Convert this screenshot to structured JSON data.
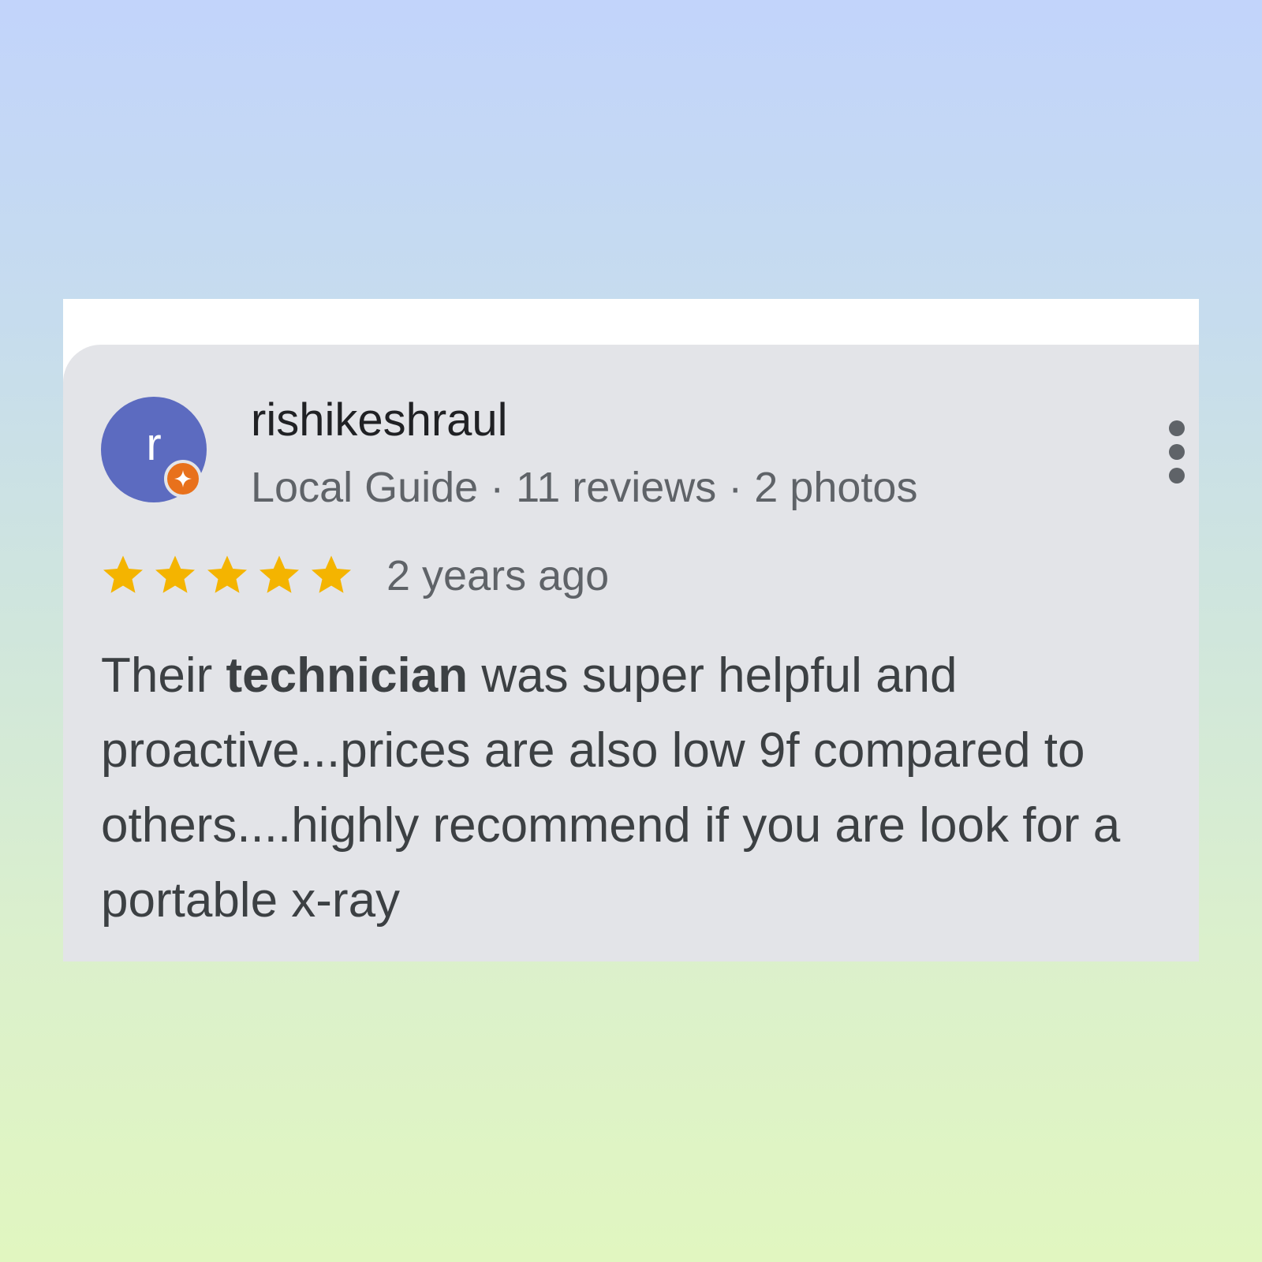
{
  "reviewer": {
    "avatar_initial": "r",
    "name": "rishikeshraul",
    "meta": "Local Guide · 11 reviews · 2 photos"
  },
  "rating": {
    "stars": 5,
    "max_stars": 5,
    "date": "2 years ago"
  },
  "review": {
    "text_before": "Their ",
    "text_bold": "technician",
    "text_after": " was super helpful and proactive...prices are also low 9f compared to others....highly recommend if you are look for a portable x-ray"
  },
  "icons": {
    "badge": "local-guide-icon",
    "menu": "more-vert-icon",
    "star": "star-icon"
  },
  "colors": {
    "avatar": "#5c6bc0",
    "badge": "#e8711c",
    "star": "#f4b400",
    "card": "#e3e4e8"
  }
}
